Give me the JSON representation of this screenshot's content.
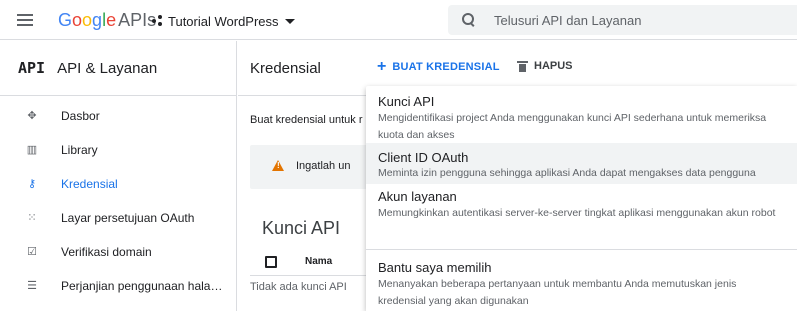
{
  "topbar": {
    "brand_google": "Google",
    "brand_apis": "APIs",
    "project_name": "Tutorial WordPress",
    "search_placeholder": "Telusuri API dan Layanan"
  },
  "sidebar": {
    "logo": "API",
    "title": "API & Layanan",
    "items": [
      {
        "label": "Dasbor",
        "icon": "dashboard-icon"
      },
      {
        "label": "Library",
        "icon": "library-icon"
      },
      {
        "label": "Kredensial",
        "icon": "key-icon",
        "active": true
      },
      {
        "label": "Layar persetujuan OAuth",
        "icon": "consent-screen-icon"
      },
      {
        "label": "Verifikasi domain",
        "icon": "domain-verification-icon"
      },
      {
        "label": "Perjanjian penggunaan hala…",
        "icon": "settings-list-icon"
      }
    ]
  },
  "header": {
    "title": "Kredensial",
    "create_label": "BUAT KREDENSIAL",
    "delete_label": "HAPUS"
  },
  "main": {
    "intro": "Buat kredensial untuk r",
    "warning": "Ingatlah un",
    "section_title": "Kunci API",
    "col_name": "Nama",
    "empty_text": "Tidak ada kunci API"
  },
  "menu": {
    "items": [
      {
        "title": "Kunci API",
        "desc": "Mengidentifikasi project Anda menggunakan kunci API sederhana untuk memeriksa kuota dan akses"
      },
      {
        "title": "Client ID OAuth",
        "desc": "Meminta izin pengguna sehingga aplikasi Anda dapat mengakses data pengguna"
      },
      {
        "title": "Akun layanan",
        "desc": "Memungkinkan autentikasi server-ke-server tingkat aplikasi menggunakan akun robot"
      },
      {
        "title": "Bantu saya memilih",
        "desc": "Menanyakan beberapa pertanyaan untuk membantu Anda memutuskan jenis kredensial yang akan digunakan"
      }
    ]
  },
  "colors": {
    "accent": "#1a73e8",
    "warning": "#e37400",
    "google_blue": "#4285f4",
    "google_red": "#ea4335",
    "google_yellow": "#fbbc05",
    "google_green": "#34a853"
  }
}
